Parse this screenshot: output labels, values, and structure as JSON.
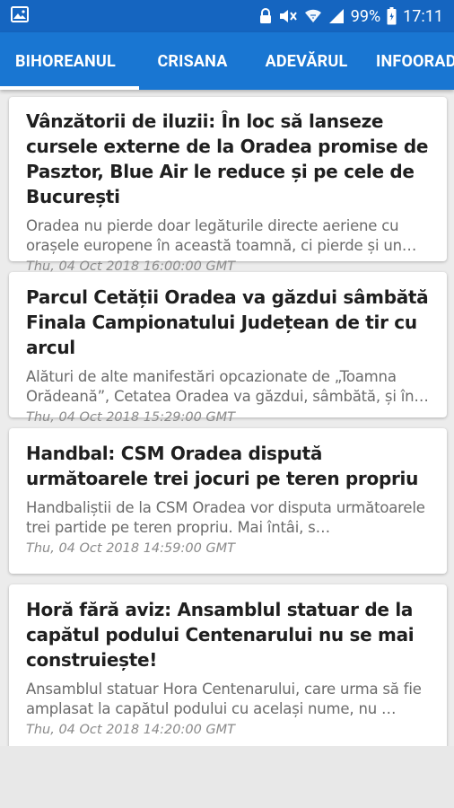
{
  "status_bar": {
    "battery": "99%",
    "time": "17:11",
    "icons": [
      "image-icon",
      "lock-icon",
      "mute-icon",
      "wifi-icon",
      "signal-icon",
      "battery-icon"
    ]
  },
  "tabs": [
    {
      "label": "BIHOREANUL",
      "active": true
    },
    {
      "label": "CRISANA",
      "active": false
    },
    {
      "label": "ADEVĂRUL",
      "active": false
    },
    {
      "label": "INFOORADEA",
      "active": false
    }
  ],
  "articles": [
    {
      "title": "Vânzătorii de iluzii: În loc să lanseze cursele externe de la Oradea promise de Pasztor, Blue Air le reduce și pe cele de București",
      "summary": "Oradea nu pierde doar legăturile directe aeriene cu orașele europene în această toamnă, ci pierde și un…",
      "date": "Thu, 04 Oct 2018 16:00:00 GMT"
    },
    {
      "title": "Parcul Cetății Oradea va găzdui sâmbătă Finala Campionatului Județean de tir cu arcul",
      "summary": "Alături de alte manifestări opcazionate de „Toamna Orădeană”, Cetatea Oradea va găzdui, sâmbătă, și în…",
      "date": "Thu, 04 Oct 2018 15:29:00 GMT"
    },
    {
      "title": "Handbal: CSM Oradea dispută următoarele trei jocuri pe teren propriu",
      "summary": "Handbaliștii de la CSM Oradea vor disputa următoarele trei partide pe teren propriu. Mai întâi, s…",
      "date": "Thu, 04 Oct 2018 14:59:00 GMT"
    },
    {
      "title": "Horă fără aviz: Ansamblul statuar de la capătul podului Centenarului nu se mai construiește!",
      "summary": "Ansamblul statuar Hora Centenarului, care urma să fie amplasat la capătul podului cu același nume, nu …",
      "date": "Thu, 04 Oct 2018 14:20:00 GMT"
    }
  ],
  "colors": {
    "status_bar": "#1565c0",
    "tab_bar": "#1976d2",
    "title_text": "#1f1f1f",
    "summary_text": "#6b6b6b",
    "date_text": "#8a8a8a"
  }
}
